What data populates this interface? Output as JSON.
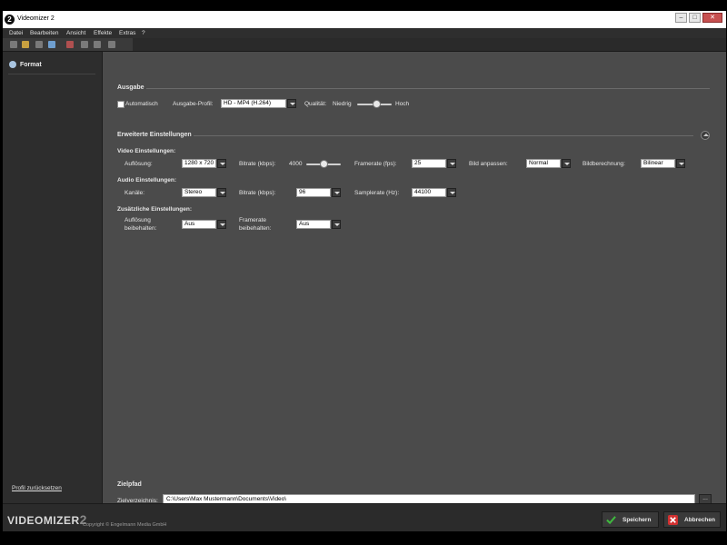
{
  "window": {
    "title": "Videomizer 2",
    "logo_glyph": "2"
  },
  "menu": [
    "Datei",
    "Bearbeiten",
    "Ansicht",
    "Effekte",
    "Extras",
    "?"
  ],
  "sidebar": {
    "item_label": "Format",
    "reset_link": "Profil zurücksetzen"
  },
  "ausgabe": {
    "title": "Ausgabe",
    "auto_label": "Automatisch",
    "profil_label": "Ausgabe-Profil:",
    "profil_value": "HD - MP4 (H.264)",
    "qualitaet_label": "Qualität:",
    "niedrig": "Niedrig",
    "hoch": "Hoch",
    "quality_level": 0.55
  },
  "erweitert": {
    "title": "Erweiterte Einstellungen",
    "video": {
      "title": "Video Einstellungen:",
      "aufloesung_label": "Auflösung:",
      "aufloesung_value": "1280 x 720",
      "bitrate_label": "Bitrate (kbps):",
      "bitrate_value": "4000",
      "bitrate_level": 0.5,
      "framerate_label": "Framerate (fps):",
      "framerate_value": "25",
      "bild_label": "Bild anpassen:",
      "bild_value": "Normal",
      "berechnung_label": "Bildberechnung:",
      "berechnung_value": "Bilinear"
    },
    "audio": {
      "title": "Audio Einstellungen:",
      "kanaele_label": "Kanäle:",
      "kanaele_value": "Stereo",
      "bitrate_label": "Bitrate (kbps):",
      "bitrate_value": "96",
      "samplerate_label": "Samplerate (Hz):",
      "samplerate_value": "44100"
    },
    "zusatz": {
      "title": "Zusätzliche Einstellungen:",
      "aufl_label_1": "Auflösung",
      "aufl_label_2": "beibehalten:",
      "aufl_value": "Aus",
      "frame_label_1": "Framerate",
      "frame_label_2": "beibehalten:",
      "frame_value": "Aus"
    }
  },
  "zielpfad": {
    "title": "Zielpfad",
    "label": "Zielverzeichnis:",
    "value": "C:\\Users\\Max Mustermann\\Documents\\Video\\",
    "browse": "..."
  },
  "footer": {
    "logo": "VIDEOMIZER",
    "logo_two": "2",
    "copyright": "Copyright © Engelmann Media GmbH",
    "save": "Speichern",
    "cancel": "Abbrechen"
  },
  "colors": {
    "save_check": "#3fb93f",
    "cancel_x": "#d23030",
    "accent": "#a8c4e0"
  }
}
